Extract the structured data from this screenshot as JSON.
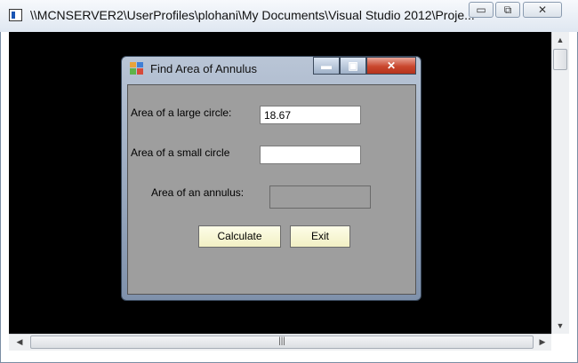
{
  "outer_window": {
    "title": "\\\\MCNSERVER2\\UserProfiles\\plohani\\My Documents\\Visual Studio 2012\\Proje...",
    "minimize_glyph": "▭",
    "restore_glyph": "⧉",
    "close_glyph": "✕",
    "scroll_up": "▲",
    "scroll_down": "▼",
    "scroll_left": "◀",
    "scroll_right": "▶",
    "grip": "|||"
  },
  "dialog": {
    "title": "Find Area of Annulus",
    "minimize_glyph": "▬",
    "maximize_glyph": "▣",
    "close_glyph": "✕",
    "large_label": "Area of a large circle:",
    "large_value": "18.67",
    "small_label": "Area of a small circle",
    "small_value": "",
    "annulus_label": "Area of an annulus:",
    "annulus_value": "",
    "calculate_label": "Calculate",
    "exit_label": "Exit"
  },
  "colors": {
    "console_bg": "#000000",
    "form_bg": "#9e9e9e",
    "button_bg": "#f8f6d8",
    "close_red": "#c9472e"
  }
}
